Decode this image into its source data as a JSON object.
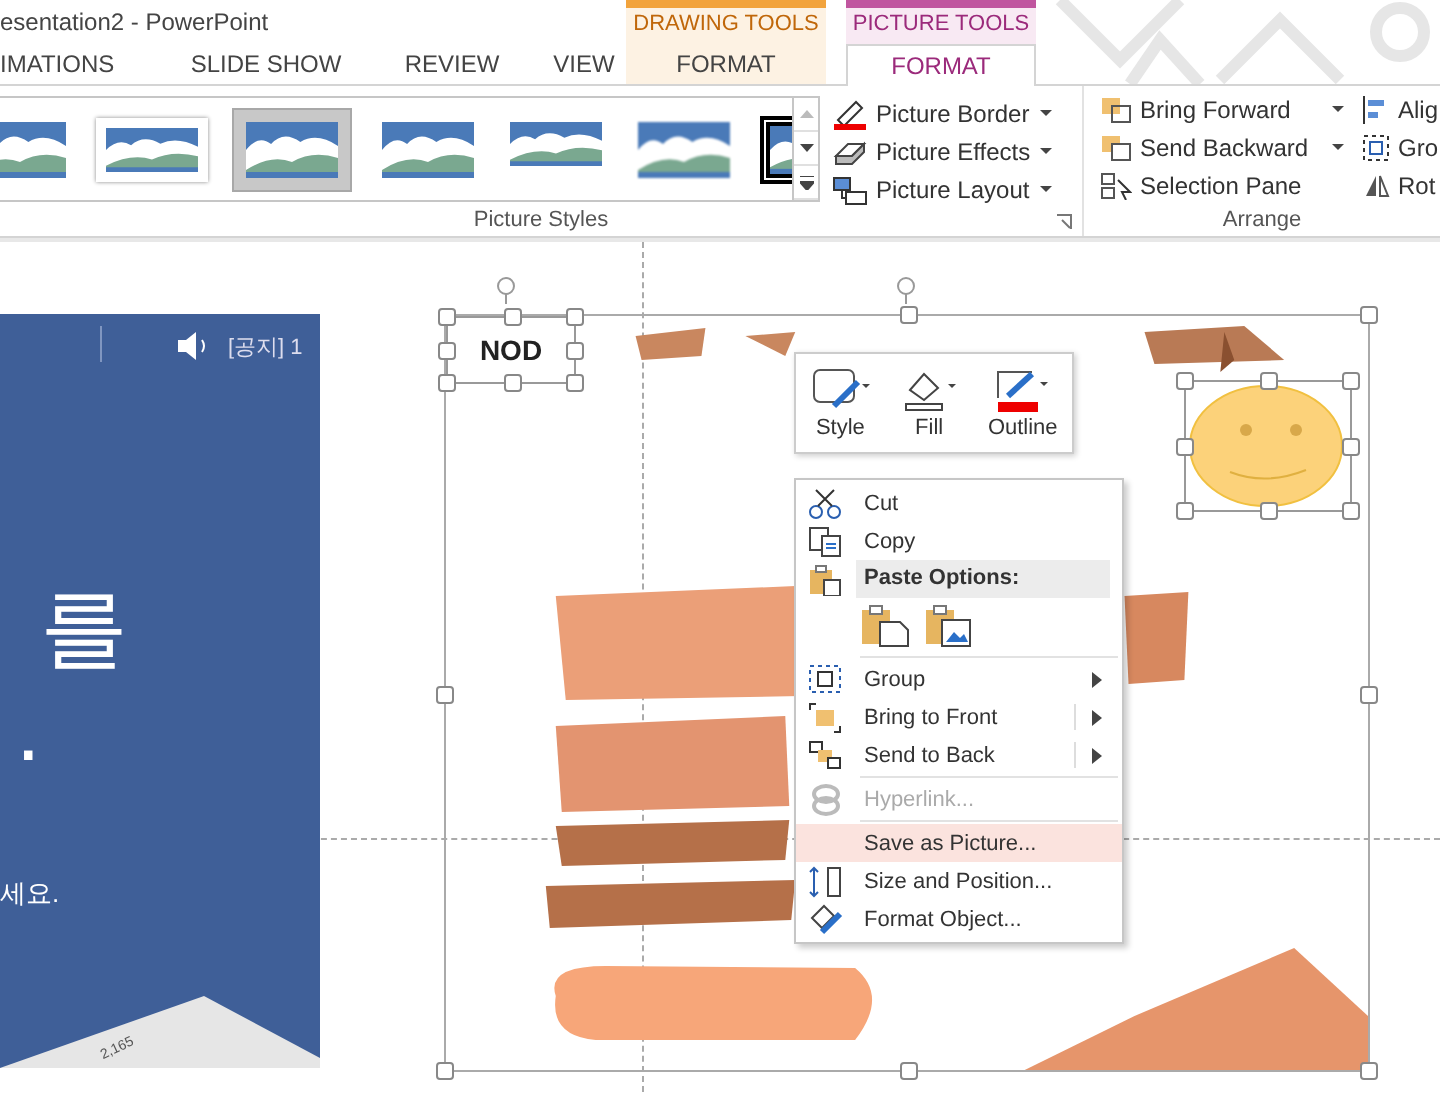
{
  "window": {
    "title": "esentation2 - PowerPoint"
  },
  "tool_groups": [
    {
      "label": "DRAWING TOOLS",
      "color": "#f2a33c"
    },
    {
      "label": "PICTURE TOOLS",
      "color": "#c0559f"
    }
  ],
  "tabs": [
    {
      "label": "IMATIONS",
      "selected": false
    },
    {
      "label": "SLIDE SHOW",
      "selected": false
    },
    {
      "label": "REVIEW",
      "selected": false
    },
    {
      "label": "VIEW",
      "selected": false
    },
    {
      "label": "FORMAT",
      "selected": false
    },
    {
      "label": "FORMAT",
      "selected": true
    }
  ],
  "picture_styles": {
    "gallery": [
      {
        "kind": "plain",
        "selected": false
      },
      {
        "kind": "white-frame",
        "selected": false
      },
      {
        "kind": "grey-frame",
        "selected": true
      },
      {
        "kind": "plain",
        "selected": false
      },
      {
        "kind": "reflection",
        "selected": false
      },
      {
        "kind": "soft-edge",
        "selected": false
      },
      {
        "kind": "black-frame",
        "selected": false
      }
    ],
    "commands": [
      "Picture Border",
      "Picture Effects",
      "Picture Layout"
    ],
    "label": "Picture Styles"
  },
  "arrange": {
    "commands": [
      {
        "label": "Bring Forward",
        "dropdown": true
      },
      {
        "label": "Send Backward",
        "dropdown": true
      },
      {
        "label": "Selection Pane",
        "dropdown": false
      }
    ],
    "commands_2": [
      "Alig",
      "Gro",
      "Rot"
    ],
    "label": "Arrange"
  },
  "left_slide": {
    "notice": "[공지] 1",
    "headline": "를",
    "headline_2": ".",
    "body": "세요.",
    "figure_label": "2,165"
  },
  "nod_label": "NOD",
  "mini_toolbar": [
    "Style",
    "Fill",
    "Outline"
  ],
  "context_menu": [
    {
      "kind": "item",
      "label": "Cut",
      "disabled": false,
      "selected": false,
      "submenu": false,
      "split": false
    },
    {
      "kind": "item",
      "label": "Copy",
      "disabled": false,
      "selected": false,
      "submenu": false,
      "split": false
    },
    {
      "kind": "header",
      "label": "Paste Options:"
    },
    {
      "kind": "paste"
    },
    {
      "kind": "separator"
    },
    {
      "kind": "item",
      "label": "Group",
      "disabled": false,
      "selected": false,
      "submenu": true,
      "split": false
    },
    {
      "kind": "item",
      "label": "Bring to Front",
      "disabled": false,
      "selected": false,
      "submenu": true,
      "split": true
    },
    {
      "kind": "item",
      "label": "Send to Back",
      "disabled": false,
      "selected": false,
      "submenu": true,
      "split": true
    },
    {
      "kind": "separator"
    },
    {
      "kind": "item",
      "label": "Hyperlink...",
      "disabled": true,
      "selected": false,
      "submenu": false,
      "split": false
    },
    {
      "kind": "separator"
    },
    {
      "kind": "item",
      "label": "Save as Picture...",
      "disabled": false,
      "selected": true,
      "submenu": false,
      "split": false
    },
    {
      "kind": "item",
      "label": "Size and Position...",
      "disabled": false,
      "selected": false,
      "submenu": false,
      "split": false
    },
    {
      "kind": "item",
      "label": "Format Object...",
      "disabled": false,
      "selected": false,
      "submenu": false,
      "split": false
    }
  ]
}
